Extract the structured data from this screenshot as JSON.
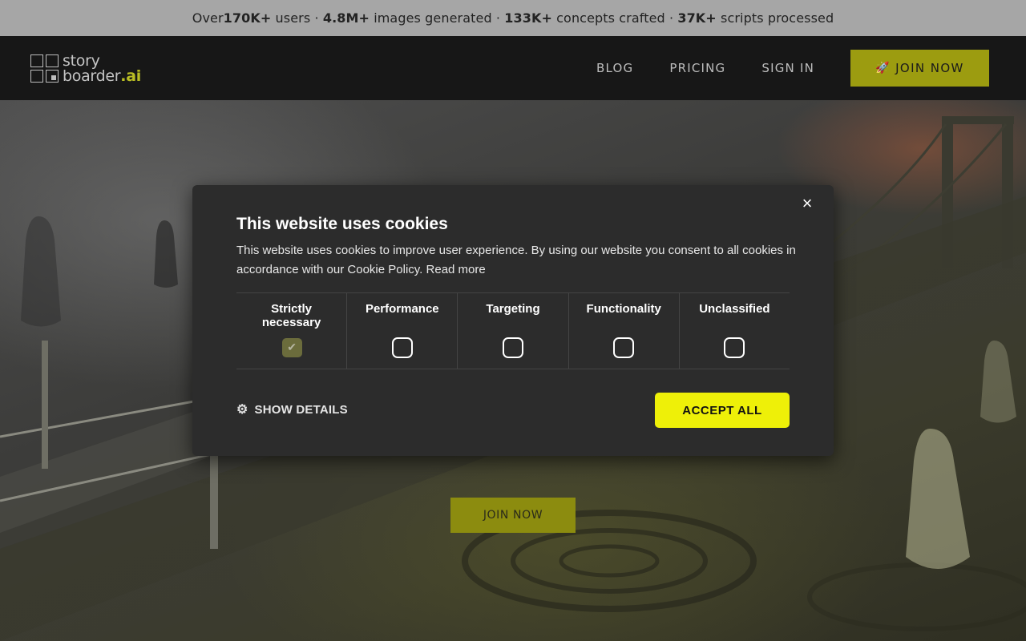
{
  "stats_bar": {
    "prefix": "Over ",
    "users_value": "170K+",
    "users_label": " users · ",
    "images_value": "4.8M+",
    "images_label": " images generated · ",
    "concepts_value": "133K+",
    "concepts_label": " concepts crafted · ",
    "scripts_value": "37K+",
    "scripts_label": " scripts processed"
  },
  "header": {
    "logo_line1": "story",
    "logo_line2": "boarder",
    "logo_suffix": ".ai",
    "nav": {
      "blog": "BLOG",
      "pricing": "PRICING",
      "sign_in": "SIGN IN",
      "join_now": "JOIN NOW"
    },
    "join_icon": "🚀"
  },
  "hero": {
    "cta_label": "JOIN NOW"
  },
  "cookie_modal": {
    "close_icon": "×",
    "title": "This website uses cookies",
    "body": "This website uses cookies to improve user experience. By using our website you consent to all cookies in accordance with our Cookie Policy.",
    "read_more": "Read more",
    "categories": [
      {
        "label": "Strictly necessary",
        "checked": true
      },
      {
        "label": "Performance",
        "checked": false
      },
      {
        "label": "Targeting",
        "checked": false
      },
      {
        "label": "Functionality",
        "checked": false
      },
      {
        "label": "Unclassified",
        "checked": false
      }
    ],
    "check_mark": "✔",
    "gear_icon": "⚙",
    "show_details": "SHOW DETAILS",
    "accept_all": "ACCEPT ALL"
  },
  "colors": {
    "accent_yellow": "#eef008",
    "brand_olive": "#9c9c10",
    "modal_bg": "#2c2c2c"
  }
}
